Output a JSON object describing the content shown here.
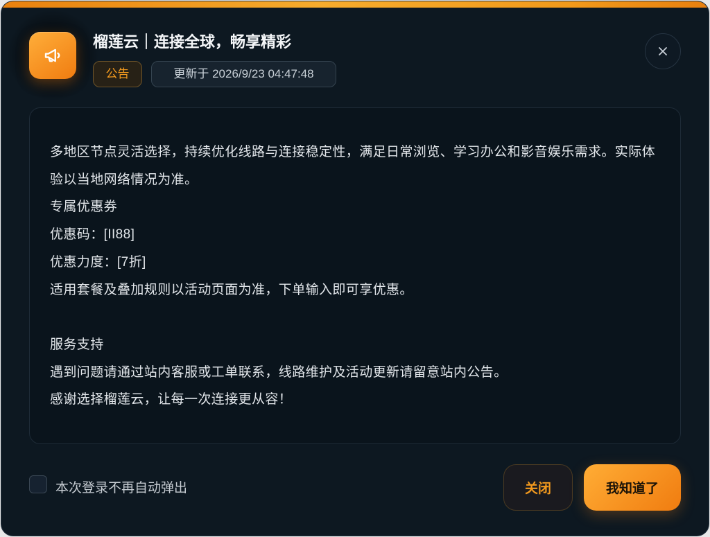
{
  "header": {
    "icon": "megaphone-icon",
    "title": "榴莲云｜连接全球，畅享精彩",
    "badge": "公告",
    "updated": "更新于 2026/9/23 04:47:48",
    "close_icon": "close-icon"
  },
  "content": {
    "intro": "多地区节点灵活选择，持续优化线路与连接稳定性，满足日常浏览、学习办公和影音娱乐需求。实际体验以当地网络情况为准。",
    "coupon_title": "专属优惠券",
    "coupon_code": "优惠码：[II88]",
    "coupon_discount": "优惠力度：[7折]",
    "coupon_note": "适用套餐及叠加规则以活动页面为准，下单输入即可享优惠。",
    "support_title": "服务支持",
    "support_text": "遇到问题请通过站内客服或工单联系，线路维护及活动更新请留意站内公告。",
    "thanks": "感谢选择榴莲云，让每一次连接更从容！"
  },
  "footer": {
    "checkbox_label": "本次登录不再自动弹出",
    "checkbox_checked": false,
    "close_button": "关闭",
    "confirm_button": "我知道了"
  },
  "colors": {
    "accent": "#f39a1e",
    "accent_deep": "#f07c10",
    "background": "#0d1821",
    "panel": "#0a141c"
  }
}
